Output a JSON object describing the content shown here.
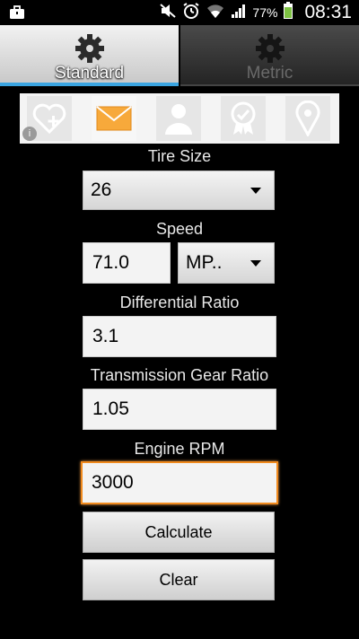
{
  "status_bar": {
    "battery_percent": "77%",
    "clock": "08:31",
    "icons": [
      "briefcase-icon",
      "mute-icon",
      "alarm-icon",
      "wifi-icon",
      "signal-icon",
      "battery-icon"
    ]
  },
  "tabs": [
    {
      "label": "Standard",
      "icon": "gear-icon",
      "selected": true
    },
    {
      "label": "Metric",
      "icon": "gear-icon",
      "selected": false
    }
  ],
  "ad_banner": {
    "icons": [
      "heart-plus-icon",
      "envelope-icon",
      "person-icon",
      "badge-icon",
      "location-pin-icon"
    ],
    "info_glyph": "i"
  },
  "form": {
    "tire_size": {
      "label": "Tire Size",
      "value": "26"
    },
    "speed": {
      "label": "Speed",
      "value": "71.0",
      "unit": "MP.."
    },
    "differential_ratio": {
      "label": "Differential Ratio",
      "value": "3.1"
    },
    "transmission_gear_ratio": {
      "label": "Transmission Gear Ratio",
      "value": "1.05"
    },
    "engine_rpm": {
      "label": "Engine RPM",
      "value": "3000"
    }
  },
  "buttons": {
    "calculate": "Calculate",
    "clear": "Clear"
  },
  "colors": {
    "background": "#000000",
    "tab_accent": "#3aa4e0",
    "focus_border": "#f08a1e",
    "battery_green": "#7dc242"
  }
}
